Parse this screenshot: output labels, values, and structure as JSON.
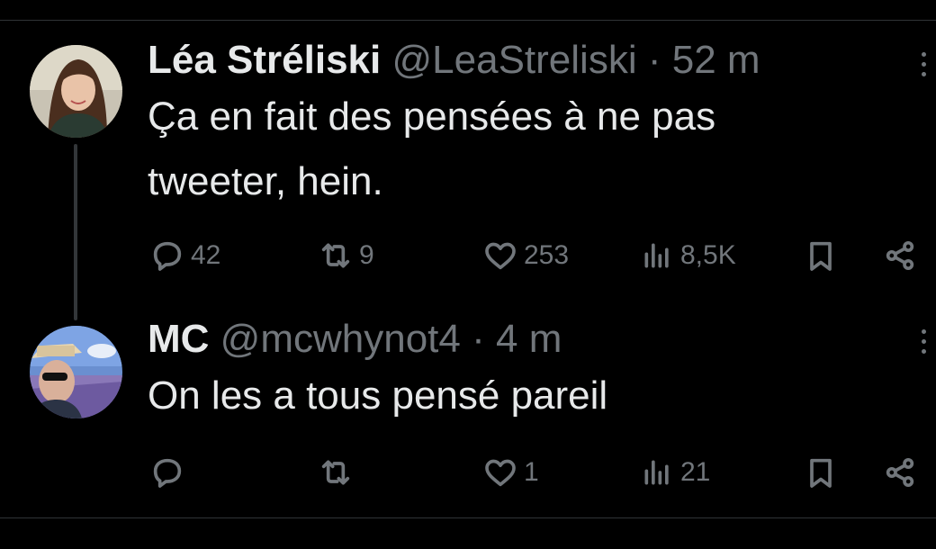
{
  "tweets": [
    {
      "name": "Léa Stréliski",
      "handle": "@LeaStreliski",
      "separator": "·",
      "time": "52 m",
      "lines": [
        "Ça en fait des pensées à ne pas",
        "tweeter, hein."
      ],
      "replies": "42",
      "retweets": "9",
      "likes": "253",
      "views": "8,5K"
    },
    {
      "name": "MC",
      "handle": "@mcwhynot4",
      "separator": "·",
      "time": "4 m",
      "lines": [
        "On les a tous pensé pareil"
      ],
      "replies": "",
      "retweets": "",
      "likes": "1",
      "views": "21"
    }
  ],
  "icons": {
    "reply": "reply-icon",
    "retweet": "retweet-icon",
    "like": "heart-icon",
    "views": "views-icon",
    "bookmark": "bookmark-icon",
    "share": "share-icon",
    "more": "more-icon"
  },
  "colors": {
    "background": "#000000",
    "text": "#e7e9ea",
    "muted": "#71767b",
    "divider": "#2f3336"
  }
}
